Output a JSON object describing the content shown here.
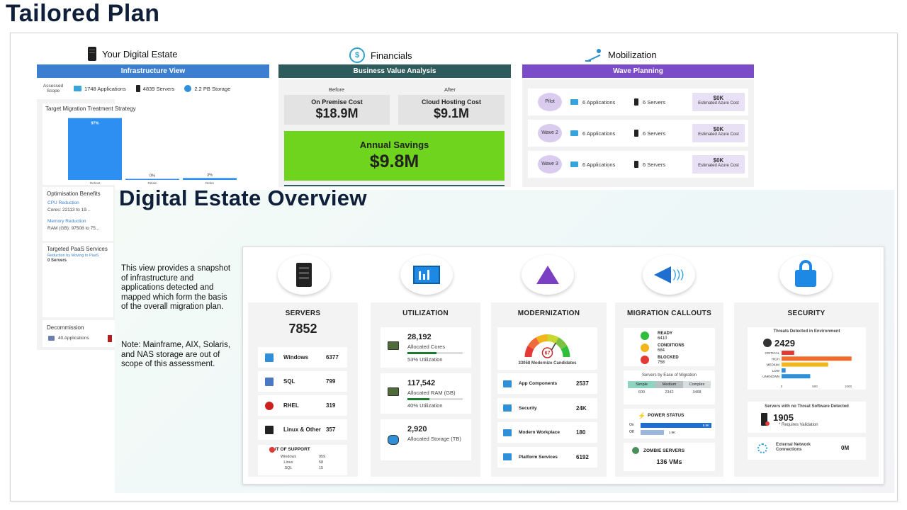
{
  "page_title": "Tailored Plan",
  "estate": {
    "heading": "Your Digital Estate",
    "bar": "Infrastructure View",
    "assessed_scope": "Assessed Scope",
    "applications": "1748 Applications",
    "servers": "4839 Servers",
    "storage": "2.2 PB Storage",
    "treatment_title": "Target Migration Treatment Strategy",
    "treatment_chart": {
      "type": "bar",
      "categories": [
        "Rehost",
        "Retain",
        "Retire"
      ],
      "values": [
        97,
        0,
        3
      ],
      "data_labels": [
        "97%",
        "0%",
        "3%"
      ],
      "ylim": [
        0,
        100
      ]
    },
    "optimisation_title": "Optimisation Benefits",
    "cpu_label": "CPU Reduction",
    "cpu_value": "Cores:   22113  to  19...",
    "mem_label": "Memory Reduction",
    "mem_value": "RAM (GB):  97508  to  75...",
    "paas_title": "Targeted PaaS Services",
    "paas_sub": "Reduction by Moving to PaaS",
    "paas_value": "0 Servers",
    "decom_title": "Decommission",
    "decom_apps": "40 Applications"
  },
  "financials": {
    "heading": "Financials",
    "bar": "Business Value Analysis",
    "before": "Before",
    "after": "After",
    "onprem_label": "On Premise Cost",
    "onprem_value": "$18.9M",
    "cloud_label": "Cloud Hosting Cost",
    "cloud_value": "$9.1M",
    "savings_label": "Annual Savings",
    "savings_value": "$9.8M"
  },
  "mobilization": {
    "heading": "Mobilization",
    "bar": "Wave Planning",
    "waves": [
      {
        "name": "Pilot",
        "apps": "6 Applications",
        "servers": "6 Servers",
        "cost": "$0K",
        "cost_label": "Estimated Azure Cost"
      },
      {
        "name": "Wave 2",
        "apps": "6 Applications",
        "servers": "6 Servers",
        "cost": "$0K",
        "cost_label": "Estimated Azure Cost"
      },
      {
        "name": "Wave 3",
        "apps": "6 Applications",
        "servers": "6 Servers",
        "cost": "$0K",
        "cost_label": "Estimated Azure Cost"
      }
    ]
  },
  "overview": {
    "title": "Digital Estate Overview",
    "description": "This view provides a snapshot of infrastructure and applications detected and mapped which form the basis of the overall migration plan.",
    "note": "Note: Mainframe, AIX, Solaris, and NAS storage are out of scope of this assessment."
  },
  "servers": {
    "title": "SERVERS",
    "total": "7852",
    "rows": [
      {
        "label": "Windows",
        "value": "6377"
      },
      {
        "label": "SQL",
        "value": "799"
      },
      {
        "label": "RHEL",
        "value": "319"
      },
      {
        "label": "Linux & Other",
        "value": "357"
      }
    ],
    "oos_title": "OUT OF SUPPORT",
    "oos": [
      {
        "label": "Windows",
        "value": "959"
      },
      {
        "label": "Linux",
        "value": "58"
      },
      {
        "label": "SQL",
        "value": "15"
      }
    ]
  },
  "utilization": {
    "title": "UTILIZATION",
    "items": [
      {
        "value": "28,192",
        "label": "Allocated Cores",
        "util": "53%  Utilization",
        "pct": 53
      },
      {
        "value": "117,542",
        "label": "Allocated RAM (GB)",
        "util": "40%  Utilization",
        "pct": 40
      },
      {
        "value": "2,920",
        "label": "Allocated Storage (TB)"
      }
    ]
  },
  "modernization": {
    "title": "MODERNIZATION",
    "gauge_value": "67",
    "gauge_pct": 67,
    "candidates": "33058 Modernize Candidates",
    "rows": [
      {
        "label": "App Components",
        "value": "2537"
      },
      {
        "label": "Security",
        "value": "24K"
      },
      {
        "label": "Modern Workplace",
        "value": "180"
      },
      {
        "label": "Platform Services",
        "value": "6192"
      }
    ]
  },
  "migration": {
    "title": "MIGRATION CALLOUTS",
    "status": [
      {
        "label": "READY",
        "value": "6410",
        "color": "#2fbf3a"
      },
      {
        "label": "CONDITIONS",
        "value": "684",
        "color": "#f2b51c"
      },
      {
        "label": "BLOCKED",
        "value": "758",
        "color": "#e53935"
      }
    ],
    "ease_title": "Servers by Ease of Migration",
    "ease": [
      {
        "label": "Simple",
        "value": "600"
      },
      {
        "label": "Medium",
        "value": "2342"
      },
      {
        "label": "Complex",
        "value": "3468"
      }
    ],
    "power_title": "POWER STATUS",
    "power": [
      {
        "label": "On",
        "value": "5.9K",
        "pct": 100
      },
      {
        "label": "Off",
        "value": "1.9K",
        "pct": 33
      }
    ],
    "zombie_title": "ZOMBIE SERVERS",
    "zombie_value": "136 VMs"
  },
  "security": {
    "title": "SECURITY",
    "threats_title": "Threats Detected in Environment",
    "threats_total": "2429",
    "threat_chart": {
      "type": "bar",
      "categories": [
        "CRITICAL",
        "HIGH",
        "MEDIUM",
        "LOW",
        "UNKNOWN"
      ],
      "values": [
        190,
        1050,
        700,
        60,
        430
      ],
      "colors": [
        "#e53935",
        "#f26b2a",
        "#f2b51c",
        "#2f8fd8",
        "#2f8fd8"
      ],
      "ticks": [
        "0",
        "500",
        "1000"
      ],
      "xlim": [
        0,
        1000
      ]
    },
    "nothreat_title": "Servers with no Threat Software Detected",
    "nothreat_value": "1905",
    "nothreat_note": "* Requires Validation",
    "network_label": "External Network Connections",
    "network_value": "0M"
  },
  "colors": {
    "infra_bar": "#3c7fd0",
    "fin_bar": "#2e5b5b",
    "wave_bar": "#7b4bc8",
    "savings": "#6fd41d"
  }
}
